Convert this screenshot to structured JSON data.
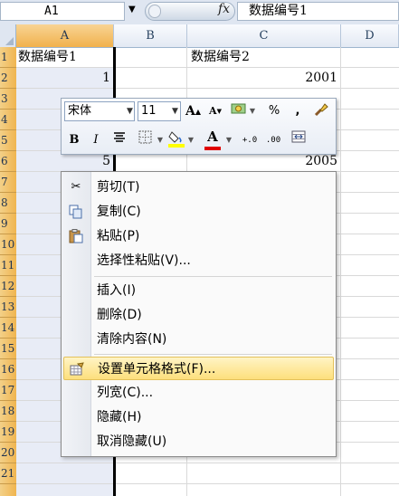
{
  "formula_bar": {
    "name_box": "A1",
    "fx_label": "fx",
    "content": "数据编号1"
  },
  "columns": [
    "A",
    "B",
    "C",
    "D"
  ],
  "rows": [
    "1",
    "2",
    "3",
    "4",
    "5",
    "6",
    "7",
    "8",
    "9",
    "10",
    "11",
    "12",
    "13",
    "14",
    "15",
    "16",
    "17",
    "18",
    "19",
    "20",
    "21"
  ],
  "cells": {
    "A1": "数据编号1",
    "A2": "1",
    "A6": "5",
    "C1": "数据编号2",
    "C2": "2001",
    "C6": "2005"
  },
  "mini_toolbar": {
    "font_name": "宋体",
    "font_size": "11",
    "grow_font": "A",
    "shrink_font": "A",
    "percent": "%",
    "comma": ",",
    "bold": "B",
    "italic": "I",
    "font_color_letter": "A",
    "increase_decimal": "+.0",
    "decrease_decimal": ".00"
  },
  "context_menu": {
    "items": [
      {
        "label": "剪切(T)",
        "icon": "scissors-icon"
      },
      {
        "label": "复制(C)",
        "icon": "copy-icon"
      },
      {
        "label": "粘贴(P)",
        "icon": "paste-icon"
      },
      {
        "label": "选择性粘贴(V)...",
        "icon": ""
      },
      {
        "label": "插入(I)",
        "icon": ""
      },
      {
        "label": "删除(D)",
        "icon": ""
      },
      {
        "label": "清除内容(N)",
        "icon": ""
      },
      {
        "label": "设置单元格格式(F)...",
        "icon": "format-cells-icon",
        "highlighted": true
      },
      {
        "label": "列宽(C)...",
        "icon": ""
      },
      {
        "label": "隐藏(H)",
        "icon": ""
      },
      {
        "label": "取消隐藏(U)",
        "icon": ""
      }
    ]
  },
  "colors": {
    "selection_header": "#f1b14c",
    "highlight_item": "#fddf7c",
    "font_color_bar": "#e00000",
    "fill_color_bar": "#ffff00"
  }
}
